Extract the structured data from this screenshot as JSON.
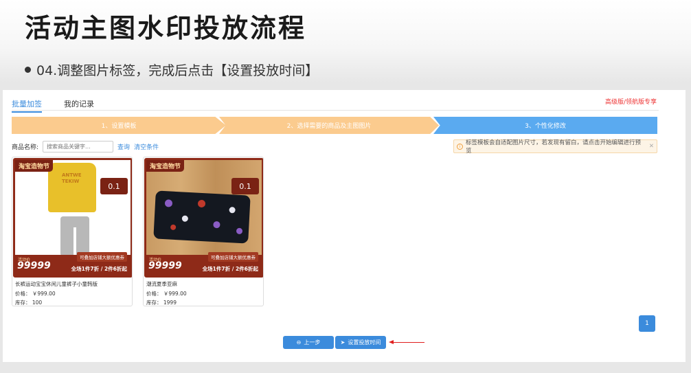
{
  "page_title": "活动主图水印投放流程",
  "subtitle": "04.调整图片标签，完成后点击【设置投放时间】",
  "tabs": [
    "批量加签",
    "我的记录"
  ],
  "vip_label": "高级版/领航版专享",
  "steps": [
    "1、设置模板",
    "2、选择需要的商品及主图图片",
    "3、个性化修改"
  ],
  "filter": {
    "label": "商品名称:",
    "placeholder": "搜索商品关键字...",
    "search": "查询",
    "clear": "清空条件"
  },
  "notice": "标签模板会自适配图片尺寸，若发现有留白，请点击开始编辑进行预览",
  "products": [
    {
      "badge": "淘宝造物节",
      "discount": "0.1",
      "price_label": "活动价",
      "price": "99999",
      "coupon": "可叠加店铺大额优惠券",
      "sale": "全场1件7折 / 2件6折起",
      "name": "长裤运动宝宝休闲儿童裤子小童韩版",
      "price_text": "价格：  ￥999.00",
      "stock_text": "库存：  100"
    },
    {
      "badge": "淘宝造物节",
      "discount": "0.1",
      "price_label": "活动价",
      "price": "99999",
      "coupon": "可叠加店铺大额优惠券",
      "sale": "全场1件7折 / 2件6折起",
      "name": "潮流夏季亚麻",
      "price_text": "价格：  ￥999.00",
      "stock_text": "库存：  1999"
    }
  ],
  "pagination": {
    "current": "1"
  },
  "buttons": {
    "prev": "上一步",
    "set_time": "设置投放时间"
  },
  "colors": {
    "primary": "#3b8bdc",
    "step_done": "#fbcb8e",
    "step_active": "#5aaaf0",
    "frame": "#8e2a18",
    "annotation": "#e01e1e"
  }
}
